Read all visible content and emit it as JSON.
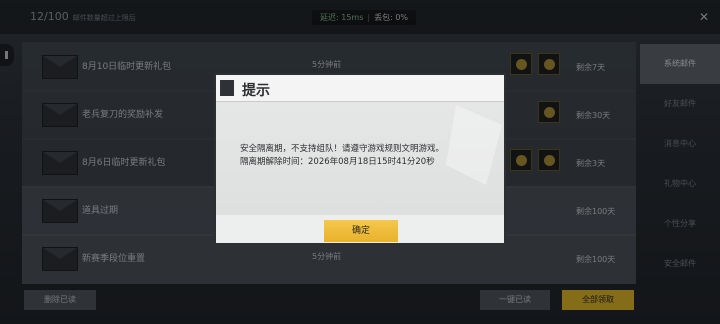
{
  "header": {
    "mail_count": "12/100",
    "mail_count_note": "邮件数量超过上限后",
    "net_latency": "延迟: 15ms",
    "net_loss": "丢包: 0%",
    "close": "✕"
  },
  "mails": [
    {
      "title": "8月10日临时更新礼包",
      "time": "5分钟前",
      "remain": "剩余7天",
      "attachments": 2
    },
    {
      "title": "老兵复刀的奖励补发",
      "time": "",
      "remain": "剩余30天",
      "attachments": 1
    },
    {
      "title": "8月6日临时更新礼包",
      "time": "",
      "remain": "剩余3天",
      "attachments": 2
    },
    {
      "title": "道具过期",
      "time": "",
      "remain": "剩余100天",
      "attachments": 0
    },
    {
      "title": "新赛季段位重置",
      "time": "5分钟前",
      "remain": "剩余100天",
      "attachments": 0
    }
  ],
  "sidebar": {
    "items": [
      {
        "label": "系统邮件",
        "active": true
      },
      {
        "label": "好友邮件",
        "active": false
      },
      {
        "label": "消息中心",
        "active": false
      },
      {
        "label": "礼物中心",
        "active": false
      },
      {
        "label": "个性分享",
        "active": false
      },
      {
        "label": "安全邮件",
        "active": false
      }
    ]
  },
  "bottom": {
    "delete_read": "删除已读",
    "read_all": "一键已读",
    "claim_all": "全部领取"
  },
  "dialog": {
    "title": "提示",
    "line1": "安全隔离期，不支持组队！请遵守游戏规则文明游戏。",
    "line2": "隔离期解除时间：2026年08月18日15时41分20秒",
    "confirm": "确定"
  }
}
